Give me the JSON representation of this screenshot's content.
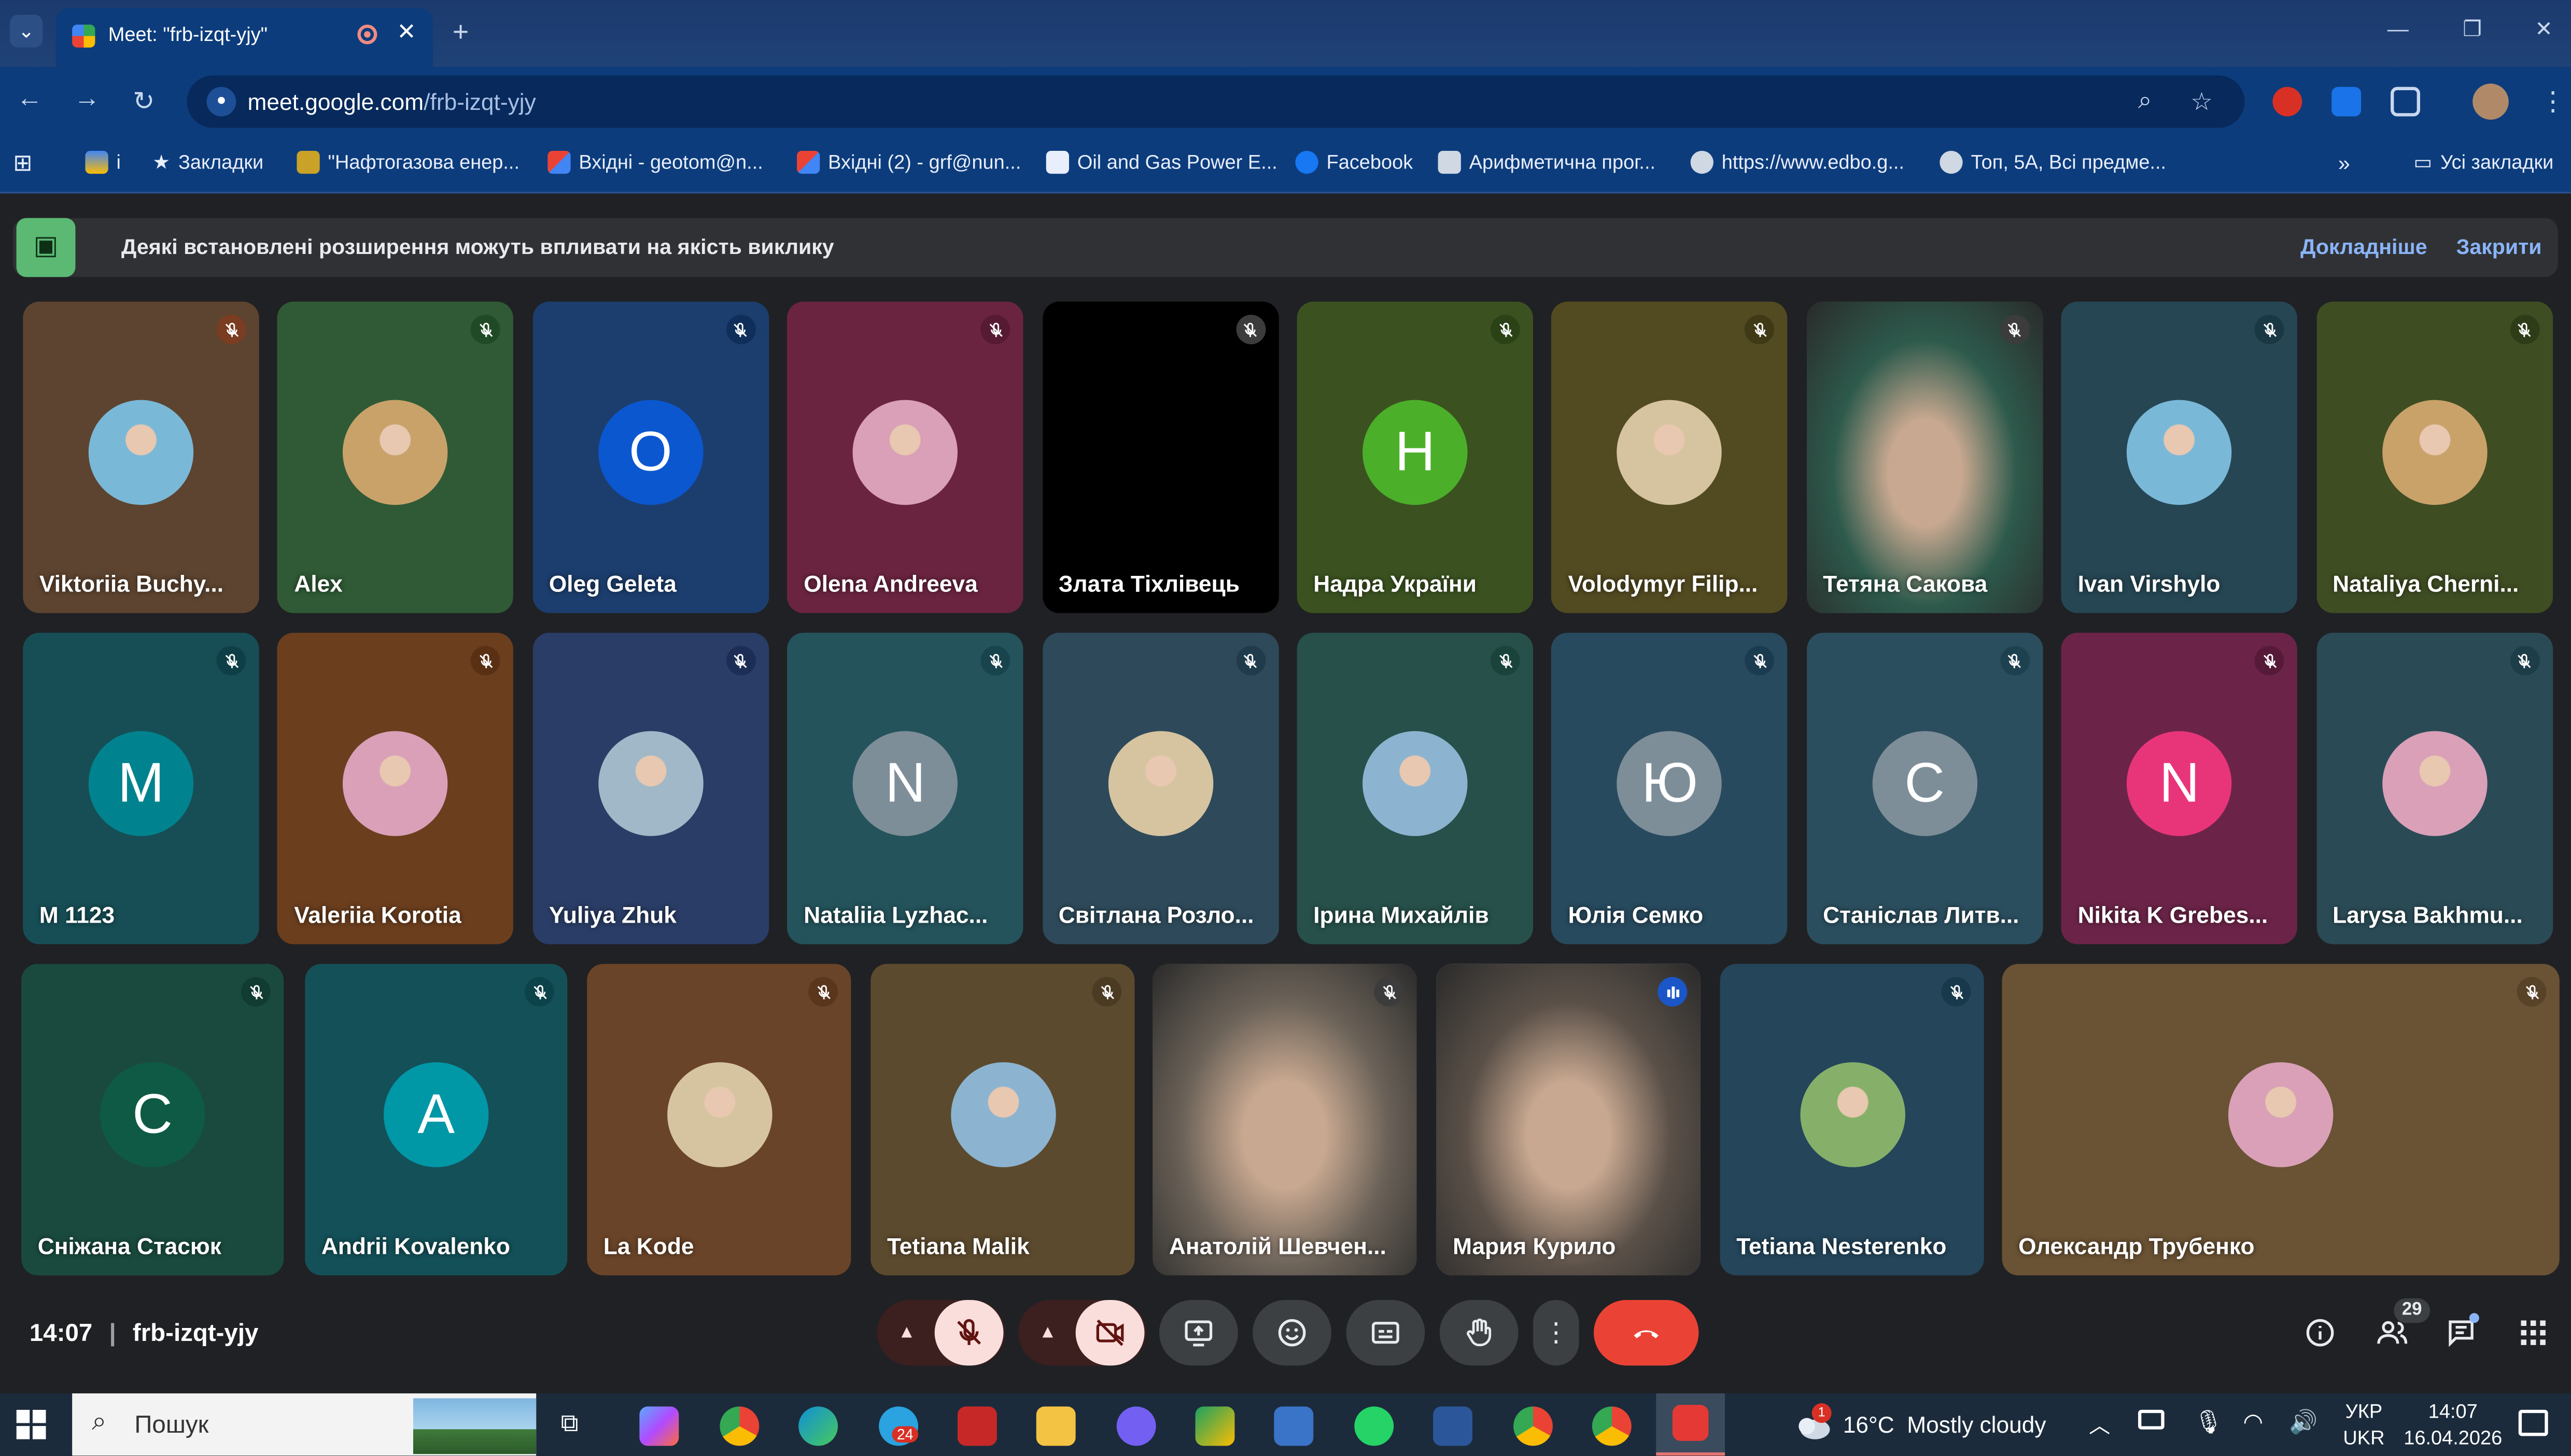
{
  "browser": {
    "tab_title": "Meet: \"frb-izqt-yjy\"",
    "url_host": "meet.google.com",
    "url_path": "/frb-izqt-yjy",
    "bookmarks": [
      {
        "label": "і",
        "icon_color": "#e8eefb"
      },
      {
        "label": "Закладки",
        "icon": "star-icon"
      },
      {
        "label": "\"Нафтогазова енер...",
        "icon_color": "#c9a227"
      },
      {
        "label": "Вхідні - geotom@n...",
        "icon_color": "#ea4335"
      },
      {
        "label": "Вхідні (2) - grf@nun...",
        "icon_color": "#ea4335"
      },
      {
        "label": "Oil and Gas Power E...",
        "icon_color": "#e8eefb"
      },
      {
        "label": "Facebook",
        "icon_color": "#1877f2"
      },
      {
        "label": "Арифметична прог...",
        "icon_color": "#cfd8e3"
      },
      {
        "label": "https://www.edbo.g...",
        "icon_color": "#cfd8e3"
      },
      {
        "label": "Топ, 5А, Всі предме...",
        "icon_color": "#cfd8e3"
      }
    ],
    "all_bookmarks": "Усі закладки"
  },
  "banner": {
    "text": "Деякі встановлені розширення можуть впливати на якість виклику",
    "learn_more": "Докладніше",
    "close": "Закрити"
  },
  "participants": [
    {
      "name": "Viktoriia Buchy...",
      "avatar": "photo",
      "tile_color": "#5d4430",
      "mute_color": "#7a3d22"
    },
    {
      "name": "Alex",
      "avatar": "photo",
      "tile_color": "#2f5a35",
      "mute_color": "#1f4a25"
    },
    {
      "name": "Oleg Geleta",
      "avatar": "O",
      "avatar_color": "#0b57d0",
      "tile_color": "#1c3e6e",
      "mute_color": "#0f2e5a"
    },
    {
      "name": "Olena Andreeva",
      "avatar": "photo",
      "tile_color": "#6b2440",
      "mute_color": "#561a32"
    },
    {
      "name": "Злата Тіхлівець",
      "avatar": "none",
      "tile_color": "#000000",
      "mute_color": "#3c3c3c"
    },
    {
      "name": "Надра України",
      "avatar": "H",
      "avatar_color": "#4caf2a",
      "tile_color": "#3b5220",
      "mute_color": "#2a4216"
    },
    {
      "name": "Volodymyr Filip...",
      "avatar": "photo",
      "tile_color": "#524a20",
      "mute_color": "#3f3915"
    },
    {
      "name": "Тетяна Сакова",
      "avatar": "video",
      "tile_color": "#2d5a4c",
      "mute_color": "#3c3c3c"
    },
    {
      "name": "Ivan Virshylo",
      "avatar": "photo",
      "tile_color": "#264653",
      "mute_color": "#1a3844"
    },
    {
      "name": "Nataliya Cherni...",
      "avatar": "photo",
      "tile_color": "#3f4d23",
      "mute_color": "#2f3c18"
    },
    {
      "name": "M 1123",
      "avatar": "M",
      "avatar_color": "#00838f",
      "tile_color": "#174e56",
      "mute_color": "#0f3f46"
    },
    {
      "name": "Valeriia Korotia",
      "avatar": "photo",
      "tile_color": "#6b3e1e",
      "mute_color": "#5a3014"
    },
    {
      "name": "Yuliya Zhuk",
      "avatar": "photo",
      "tile_color": "#2a3d66",
      "mute_color": "#1c2e55"
    },
    {
      "name": "Nataliia Lyzhac...",
      "avatar": "N",
      "avatar_color": "#7d8e99",
      "tile_color": "#24535c",
      "mute_color": "#18444d"
    },
    {
      "name": "Світлана Розло...",
      "avatar": "photo",
      "tile_color": "#2e4a5a",
      "mute_color": "#203c4c"
    },
    {
      "name": "Ірина Михайлів",
      "avatar": "photo",
      "tile_color": "#27504a",
      "mute_color": "#1a433c"
    },
    {
      "name": "Юлія Семко",
      "avatar": "Ю",
      "avatar_color": "#7d8e99",
      "tile_color": "#284a5e",
      "mute_color": "#1b3c50"
    },
    {
      "name": "Станіслав Литв...",
      "avatar": "С",
      "avatar_color": "#7d8e99",
      "tile_color": "#2b4e5e",
      "mute_color": "#1e4150"
    },
    {
      "name": "Nikita K Grebes...",
      "avatar": "N",
      "avatar_color": "#e8357a",
      "tile_color": "#6b2448",
      "mute_color": "#561a38"
    },
    {
      "name": "Larysa Bakhmu...",
      "avatar": "photo",
      "tile_color": "#2a4b56",
      "mute_color": "#1d3d48"
    },
    {
      "name": "Сніжана Стасюк",
      "avatar": "С",
      "avatar_color": "#0e5a44",
      "tile_color": "#1a4a3e",
      "mute_color": "#103c31"
    },
    {
      "name": "Andrii Kovalenko",
      "avatar": "A",
      "avatar_color": "#0097a7",
      "tile_color": "#145058",
      "mute_color": "#0c424a"
    },
    {
      "name": "La Kode",
      "avatar": "photo",
      "tile_color": "#6a4428",
      "mute_color": "#59361c"
    },
    {
      "name": "Tetiana Malik",
      "avatar": "photo",
      "tile_color": "#5c4a2e",
      "mute_color": "#4b3b22"
    },
    {
      "name": "Анатолій Шевчен...",
      "avatar": "video",
      "tile_color": "#6b6258",
      "mute_color": "#3c3c3c"
    },
    {
      "name": "Мария Курило",
      "avatar": "video",
      "tile_color": "#5a5048",
      "mute_color": "#1a56c8",
      "speaking": true
    },
    {
      "name": "Tetiana Nesterenko",
      "avatar": "photo",
      "tile_color": "#24455a",
      "mute_color": "#18394c"
    },
    {
      "name": "Олександр Трубенко",
      "avatar": "photo",
      "tile_color": "#6a5234",
      "mute_color": "#584228"
    }
  ],
  "meeting": {
    "time": "14:07",
    "code": "frb-izqt-yjy",
    "participant_count": "29"
  },
  "taskbar": {
    "search_placeholder": "Пошук",
    "weather": "16°C  Mostly cloudy",
    "language_line1": "УКР",
    "language_line2": "UKR",
    "clock_time": "14:07",
    "clock_date": "16.04.2026",
    "telegram_badge": "24",
    "notification_badge": "1"
  },
  "colors": {
    "end_call": "#ea4335",
    "muted_ctrl": "#f9dedc",
    "chrome_blue": "#0c3c7c"
  }
}
